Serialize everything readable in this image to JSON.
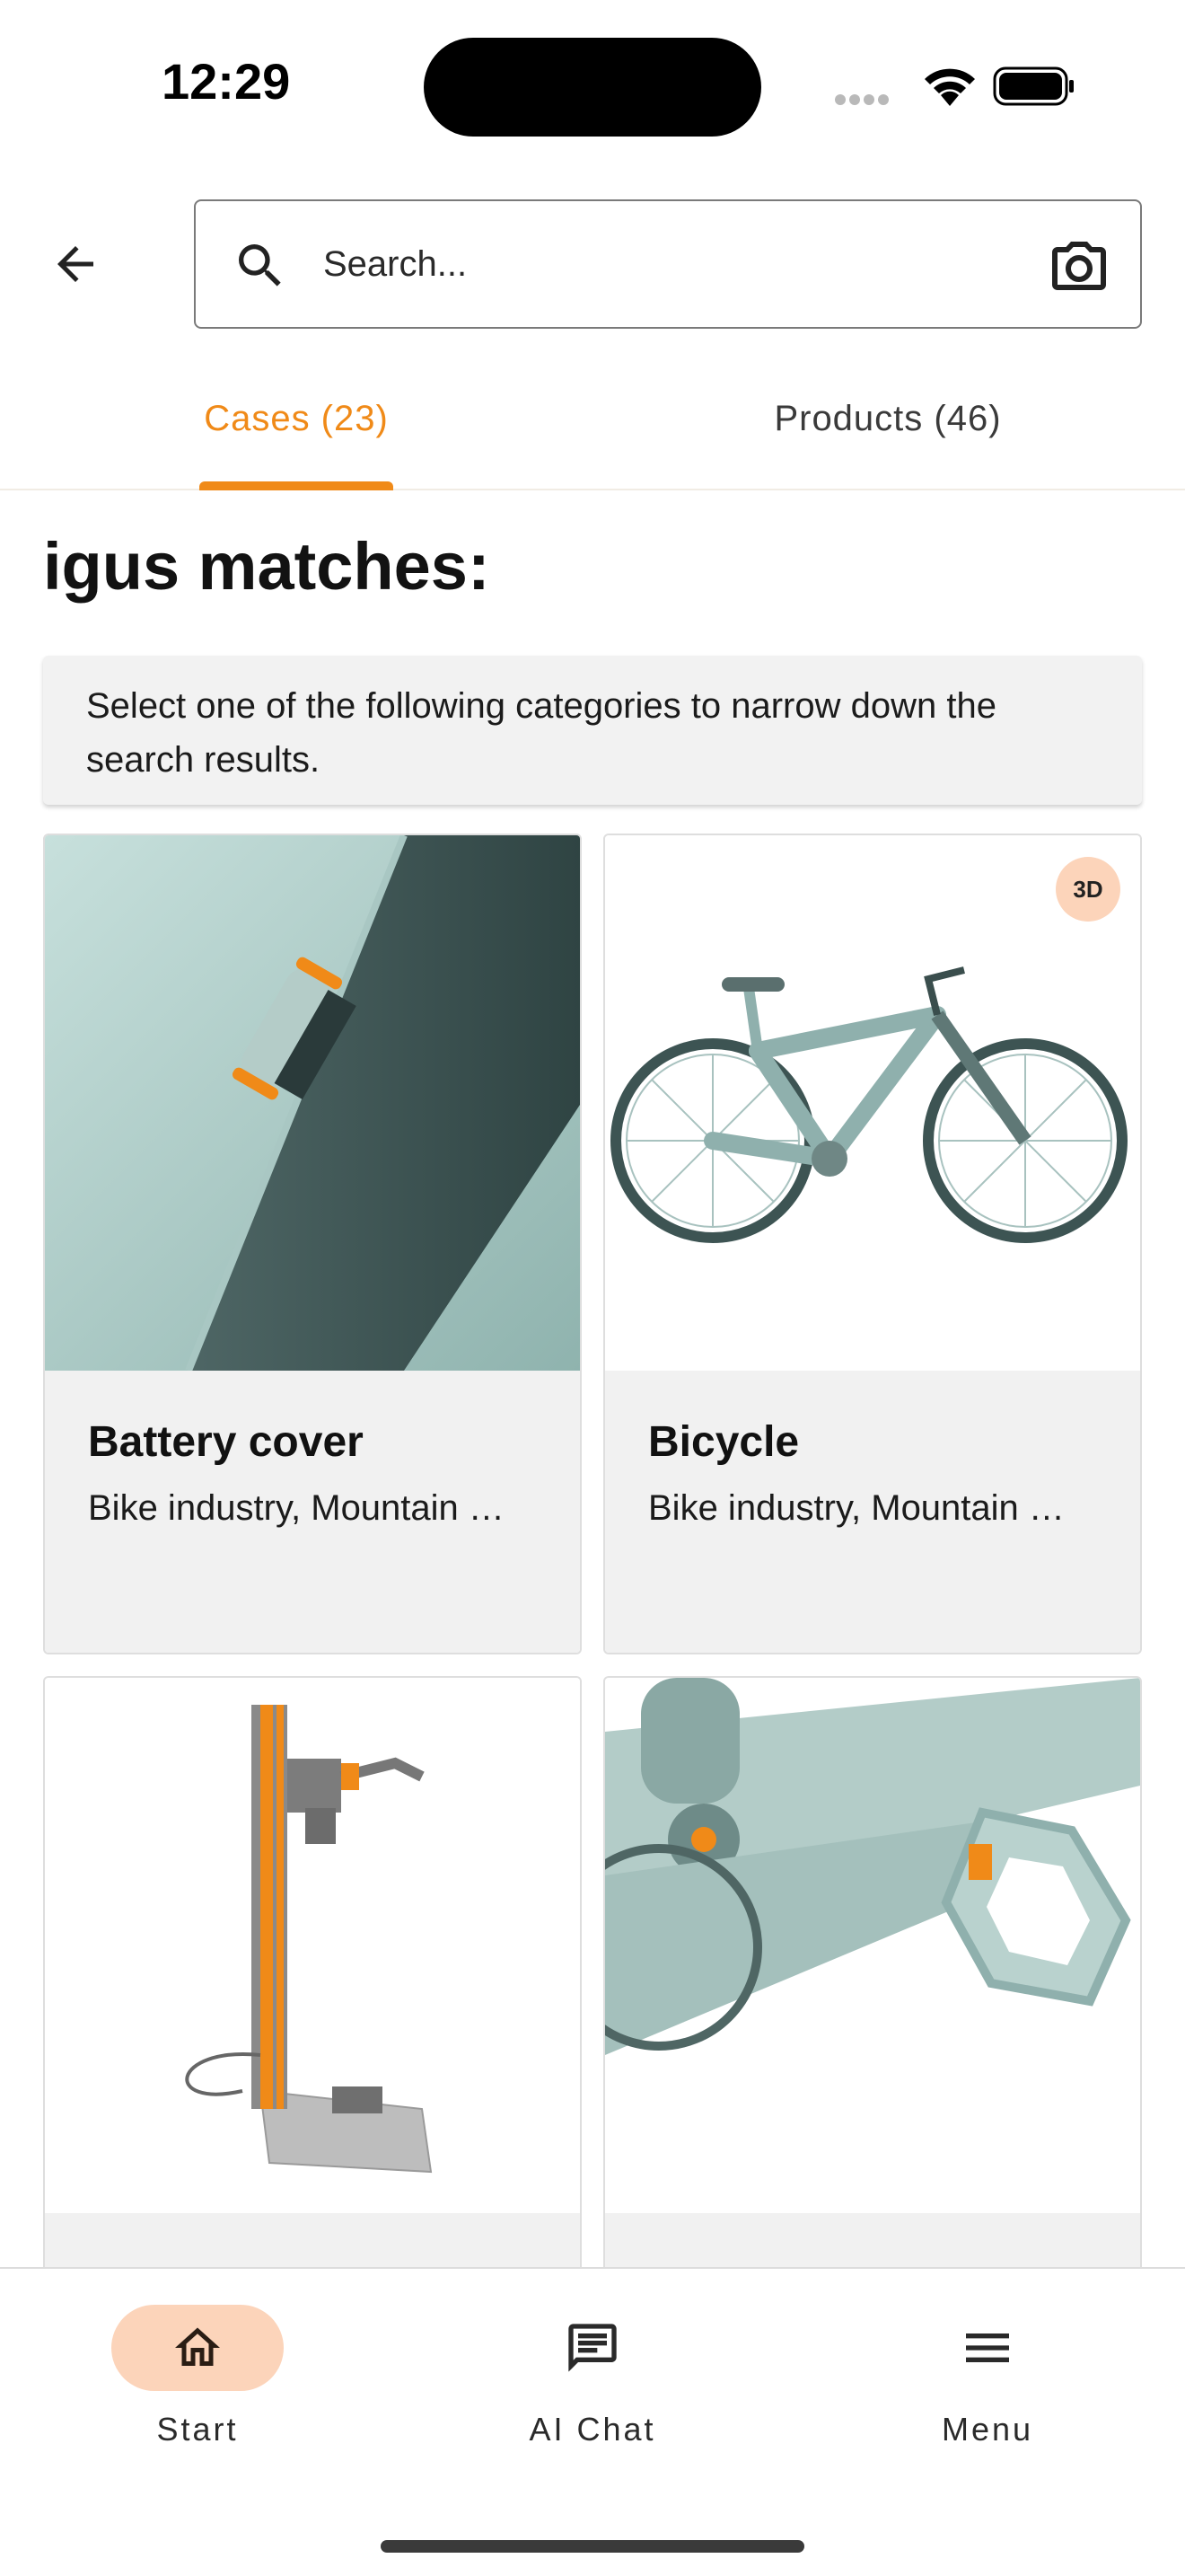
{
  "status_bar": {
    "time": "12:29"
  },
  "search": {
    "placeholder": "Search..."
  },
  "tabs": [
    {
      "label": "Cases (23)",
      "active": true
    },
    {
      "label": "Products (46)",
      "active": false
    }
  ],
  "page_title": "igus matches:",
  "info_text": "Select one of the following categories to narrow down the search results.",
  "cards": [
    {
      "title": "Battery cover",
      "subtitle": "Bike industry, Mountain …",
      "badge": ""
    },
    {
      "title": "Bicycle",
      "subtitle": "Bike industry, Mountain …",
      "badge": "3D"
    },
    {
      "title": "",
      "subtitle": "",
      "badge": ""
    },
    {
      "title": "",
      "subtitle": "",
      "badge": ""
    }
  ],
  "bottom_nav": [
    {
      "label": "Start",
      "icon": "home-icon",
      "active": true
    },
    {
      "label": "AI Chat",
      "icon": "chat-icon",
      "active": false
    },
    {
      "label": "Menu",
      "icon": "menu-icon",
      "active": false
    }
  ],
  "colors": {
    "accent": "#f08a18",
    "badge_bg": "#fcd4ba",
    "card_body": "#f1f1f1"
  }
}
